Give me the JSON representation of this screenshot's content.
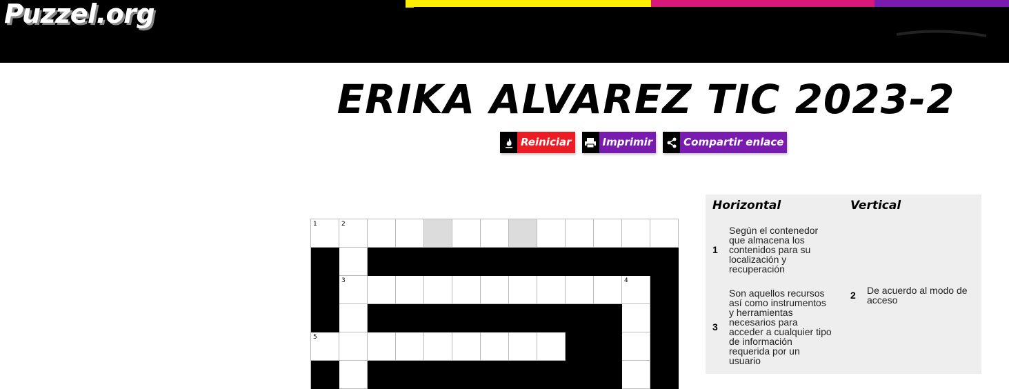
{
  "header": {
    "logo": "Puzzel.org"
  },
  "puzzle": {
    "title": "ERIKA ALVAREZ TIC 2023-2"
  },
  "actions": [
    {
      "label": "Reiniciar",
      "icon": "reset-icon"
    },
    {
      "label": "Imprimir",
      "icon": "print-icon"
    },
    {
      "label": "Compartir enlace",
      "icon": "share-icon"
    }
  ],
  "grid": {
    "rows": [
      [
        "w1",
        "w2",
        "w",
        "w",
        "g",
        "w",
        "w",
        "g",
        "w",
        "w",
        "w",
        "w",
        "w"
      ],
      [
        "b",
        "w",
        "b",
        "b",
        "b",
        "b",
        "b",
        "b",
        "b",
        "b",
        "b",
        "b",
        "b"
      ],
      [
        "b",
        "w3",
        "w",
        "w",
        "w",
        "w",
        "w",
        "w",
        "w",
        "w",
        "w",
        "w4",
        "b"
      ],
      [
        "b",
        "w",
        "b",
        "b",
        "b",
        "b",
        "b",
        "b",
        "b",
        "b",
        "b",
        "w",
        "b"
      ],
      [
        "w5",
        "w",
        "w",
        "w",
        "w",
        "w",
        "w",
        "w",
        "w",
        "b",
        "b",
        "w",
        "b"
      ],
      [
        "b",
        "w",
        "b",
        "b",
        "b",
        "b",
        "b",
        "b",
        "b",
        "b",
        "b",
        "w",
        "b"
      ]
    ]
  },
  "clues": {
    "horizontal_heading": "Horizontal",
    "vertical_heading": "Vertical",
    "horizontal": [
      {
        "number": "1",
        "text": "Según el contenedor que almacena los contenidos para su localización y recuperación"
      },
      {
        "number": "3",
        "text": "Son aquellos recursos así como instrumentos y herramientas necesarios para acceder a cualquier tipo de información requerida por un usuario"
      }
    ],
    "vertical": [
      {
        "number": "2",
        "text": "De acuerdo al modo de acceso"
      }
    ]
  },
  "colors": {
    "accent_red": "#ec1c24",
    "accent_purple": "#7a1bb0",
    "stripe_yellow": "#ffee00",
    "stripe_magenta": "#d6197a"
  }
}
